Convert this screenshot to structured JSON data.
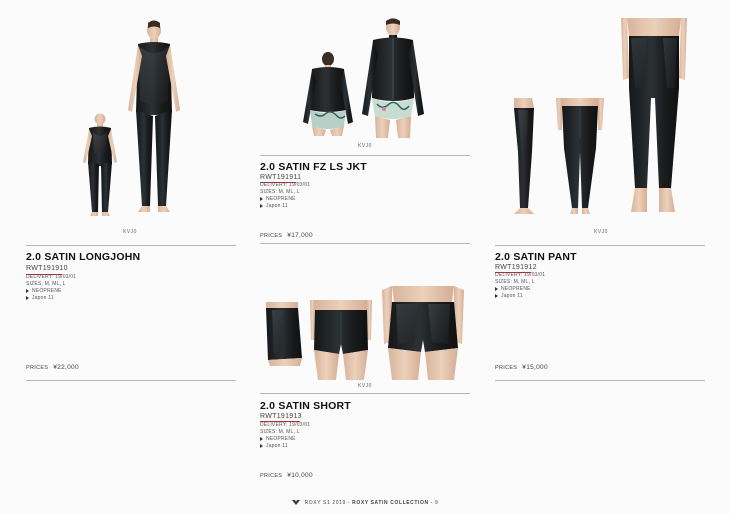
{
  "footer": {
    "season": "ROXY S1 2019",
    "separator": "-",
    "collection": "ROXY SATIN COLLECTION",
    "page_number": "9"
  },
  "products": {
    "longjohn": {
      "swatch_label": "KVJ0",
      "title": "2.0 SATIN LONGJOHN",
      "code": "RWT191910",
      "delivery": "DELIVERY: 19/03/01",
      "sizes": "SIZES: M, ML, L",
      "features": [
        "NEOPRENE",
        "Japon 11"
      ],
      "price_label": "PRICES",
      "price": "¥22,000"
    },
    "jacket": {
      "swatch_label": "KVJ0",
      "title": "2.0 SATIN FZ LS JKT",
      "code": "RWT191911",
      "delivery": "DELIVERY: 19/03/01",
      "sizes": "SIZES: M, ML, L",
      "features": [
        "NEOPRENE",
        "Japon 11"
      ],
      "price_label": "PRICES",
      "price": "¥17,000"
    },
    "pant": {
      "swatch_label": "KVJ0",
      "title": "2.0 SATIN PANT",
      "code": "RWT191912",
      "delivery": "DELIVERY: 19/03/01",
      "sizes": "SIZES: M, ML, L",
      "features": [
        "NEOPRENE",
        "Japon 11"
      ],
      "price_label": "PRICES",
      "price": "¥15,000"
    },
    "short": {
      "swatch_label": "KVJ0",
      "title": "2.0 SATIN SHORT",
      "code": "RWT191913",
      "delivery": "DELIVERY: 19/03/01",
      "sizes": "SIZES: M, ML, L",
      "features": [
        "NEOPRENE",
        "Japon 11"
      ],
      "price_label": "PRICES",
      "price": "¥10,000"
    }
  },
  "colors": {
    "suit": "#1b1d1e",
    "suit_sheen": "#3a3f42",
    "skin": "#e3c3ab",
    "accent_underline": "#c0292f"
  }
}
